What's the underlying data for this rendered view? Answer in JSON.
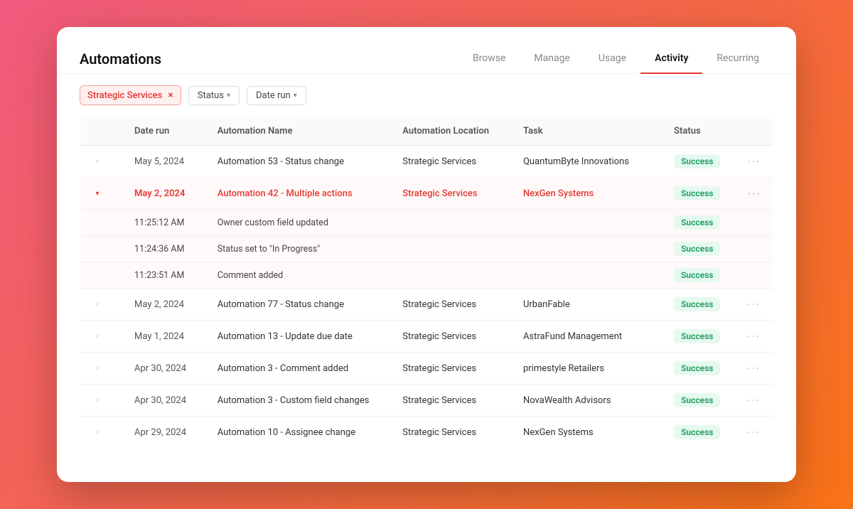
{
  "page": {
    "title": "Automations"
  },
  "tabs": [
    {
      "id": "browse",
      "label": "Browse",
      "active": false
    },
    {
      "id": "manage",
      "label": "Manage",
      "active": false
    },
    {
      "id": "usage",
      "label": "Usage",
      "active": false
    },
    {
      "id": "activity",
      "label": "Activity",
      "active": true
    },
    {
      "id": "recurring",
      "label": "Recurring",
      "active": false
    }
  ],
  "filters": {
    "tag": "Strategic Services",
    "remove_label": "×",
    "status_label": "Status",
    "date_run_label": "Date run"
  },
  "table": {
    "columns": [
      "Date run",
      "Automation Name",
      "Automation Location",
      "Task",
      "Status"
    ],
    "rows": [
      {
        "id": "row1",
        "expanded": false,
        "date": "May 5, 2024",
        "name": "Automation 53 - Status change",
        "location": "Strategic Services",
        "task": "QuantumByte Innovations",
        "status": "Success",
        "highlighted": false,
        "sub_rows": []
      },
      {
        "id": "row2",
        "expanded": true,
        "date": "May 2, 2024",
        "name": "Automation 42 - Multiple actions",
        "location": "Strategic Services",
        "task": "NexGen Systems",
        "status": "Success",
        "highlighted": true,
        "sub_rows": [
          {
            "time": "11:25:12 AM",
            "action": "Owner custom field updated",
            "status": "Success"
          },
          {
            "time": "11:24:36 AM",
            "action": "Status set to \"In Progress\"",
            "status": "Success"
          },
          {
            "time": "11:23:51 AM",
            "action": "Comment added",
            "status": "Success"
          }
        ]
      },
      {
        "id": "row3",
        "expanded": false,
        "date": "May 2, 2024",
        "name": "Automation 77 - Status change",
        "location": "Strategic Services",
        "task": "UrbanFable",
        "status": "Success",
        "highlighted": false,
        "sub_rows": []
      },
      {
        "id": "row4",
        "expanded": false,
        "date": "May 1, 2024",
        "name": "Automation 13 - Update due date",
        "location": "Strategic Services",
        "task": "AstraFund Management",
        "status": "Success",
        "highlighted": false,
        "sub_rows": []
      },
      {
        "id": "row5",
        "expanded": false,
        "date": "Apr 30, 2024",
        "name": "Automation 3 - Comment added",
        "location": "Strategic Services",
        "task": "primestyle Retailers",
        "status": "Success",
        "highlighted": false,
        "sub_rows": []
      },
      {
        "id": "row6",
        "expanded": false,
        "date": "Apr 30, 2024",
        "name": "Automation 3 - Custom field changes",
        "location": "Strategic Services",
        "task": "NovaWealth Advisors",
        "status": "Success",
        "highlighted": false,
        "sub_rows": []
      },
      {
        "id": "row7",
        "expanded": false,
        "date": "Apr 29, 2024",
        "name": "Automation 10 - Assignee change",
        "location": "Strategic Services",
        "task": "NexGen Systems",
        "status": "Success",
        "highlighted": false,
        "sub_rows": []
      }
    ]
  }
}
